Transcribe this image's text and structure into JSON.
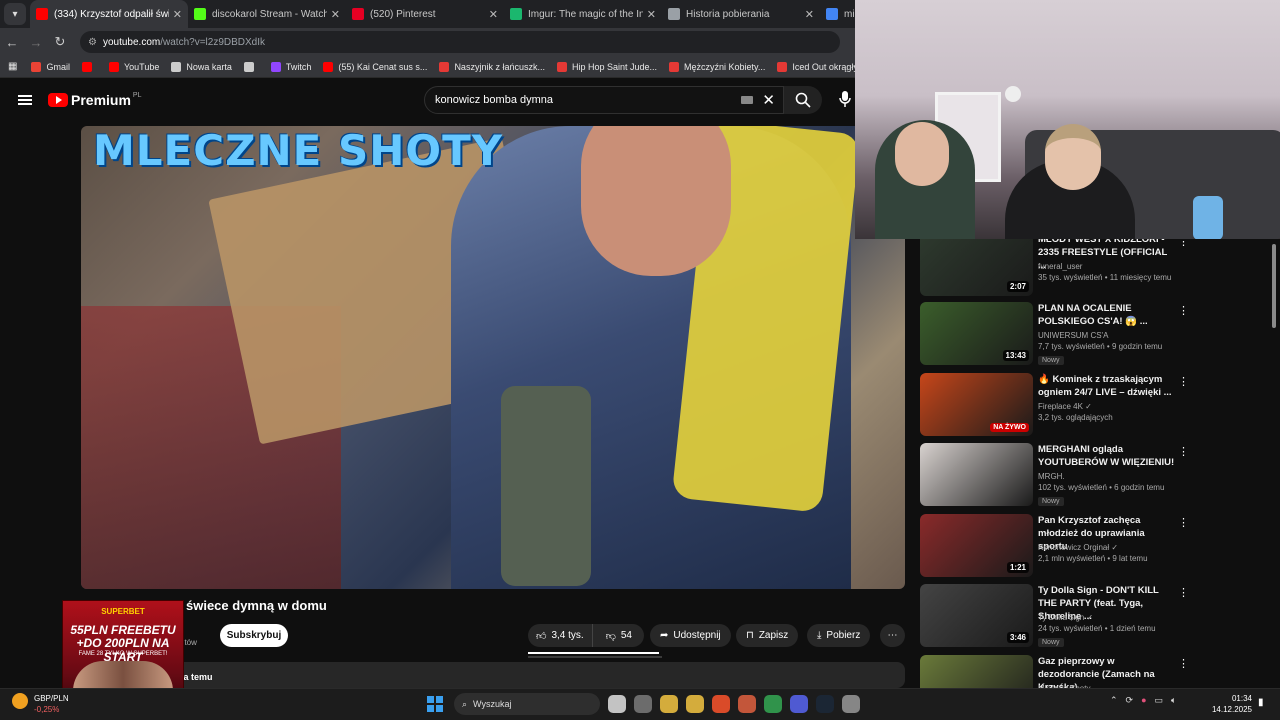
{
  "browser": {
    "tabs": [
      {
        "label": "(334) Krzysztof odpalił świe",
        "active": true,
        "icon": "youtube-icon",
        "color": "#ff0000"
      },
      {
        "label": "discokarol Stream - Watch Live",
        "active": false,
        "icon": "kick-icon",
        "color": "#53fc18"
      },
      {
        "label": "(520) Pinterest",
        "active": false,
        "icon": "pinterest-icon",
        "color": "#e60023"
      },
      {
        "label": "Imgur: The magic of the Interne",
        "active": false,
        "icon": "imgur-icon",
        "color": "#1bb76e"
      },
      {
        "label": "Historia pobierania",
        "active": false,
        "icon": "download-icon",
        "color": "#9aa0a6"
      },
      {
        "label": "mid",
        "active": false,
        "icon": "google-icon",
        "color": "#4285f4"
      }
    ],
    "url_host": "youtube.com",
    "url_path": "/watch?v=l2z9DBDXdIk",
    "bookmarks": [
      {
        "label": "Gmail",
        "color": "#ea4335"
      },
      {
        "label": "",
        "color": "#ff0000"
      },
      {
        "label": "YouTube",
        "color": "#ff0000"
      },
      {
        "label": "Nowa karta",
        "color": "#cccccc"
      },
      {
        "label": "",
        "color": "#cccccc"
      },
      {
        "label": "Twitch",
        "color": "#9146ff"
      },
      {
        "label": "(55) Kai Cenat sus s...",
        "color": "#ff0000"
      },
      {
        "label": "Naszyjnik z łańcuszk...",
        "color": "#e53935"
      },
      {
        "label": "Hip Hop Saint Jude...",
        "color": "#e53935"
      },
      {
        "label": "Mężczyźni Kobiety...",
        "color": "#e53935"
      },
      {
        "label": "Iced Out okrągły ini...",
        "color": "#e53935"
      }
    ]
  },
  "youtube": {
    "logo": "Premium",
    "logo_country": "PL",
    "search_value": "konowicz bomba dymna",
    "video_overlay_text": "MLECZNE SHOTY",
    "video_title": "świece dymną w domu",
    "channel_sub": "ntów",
    "subscribe_label": "Subskrybuj",
    "likes": "3,4 tys.",
    "dislikes": "54",
    "share_label": "Udostępnij",
    "save_label": "Zapisz",
    "download_label": "Pobierz",
    "description_meta": "lata temu",
    "like_ratio": 0.98
  },
  "ad": {
    "brand": "SUPERBET",
    "line1": "55PLN FREEBETU",
    "line2": "+DO 200PLN NA START",
    "line3": "FAME 28 TYLKO W SUPERBET!"
  },
  "recommendations": [
    {
      "title": "MŁODY WEST X KIDZLORI - 2335 FREESTYLE (OFFICIAL ...",
      "channel": "funeral_user",
      "meta": "35 tys. wyświetleń • 11 miesięcy temu",
      "duration": "2:07",
      "live": false,
      "new": false,
      "verified": false,
      "thumb_color": "#2e3a2e"
    },
    {
      "title": "PLAN NA OCALENIE POLSKIEGO CS'A! 😱 ...",
      "channel": "UNIWERSUM CS'A",
      "meta": "7,7 tys. wyświetleń • 9 godzin temu",
      "duration": "13:43",
      "live": false,
      "new": true,
      "verified": false,
      "thumb_color": "#3b5e2b"
    },
    {
      "title": "🔥 Kominek z trzaskającym ogniem 24/7 LIVE – dźwięki ...",
      "channel": "Fireplace 4K",
      "meta": "3,2 tys. oglądających",
      "duration": "NA ŻYWO",
      "live": true,
      "new": false,
      "verified": true,
      "thumb_color": "#c6461a"
    },
    {
      "title": "MERGHANI ogląda YOUTUBERÓW W WIĘZIENIU!",
      "channel": "MRGH.",
      "meta": "102 tys. wyświetleń • 6 godzin temu",
      "duration": "",
      "live": false,
      "new": true,
      "verified": false,
      "thumb_color": "#d8d2cf"
    },
    {
      "title": "Pan Krzysztof zachęca młodzież do uprawiania sportu",
      "channel": "Kononowicz Orginał",
      "meta": "2,1 mln wyświetleń • 9 lat temu",
      "duration": "1:21",
      "live": false,
      "new": false,
      "verified": true,
      "thumb_color": "#8a2a2a"
    },
    {
      "title": "Ty Dolla Sign - DON'T KILL THE PARTY (feat. Tyga, Shoreline ...",
      "channel": "Ty Dolla $ign",
      "meta": "24 tys. wyświetleń • 1 dzień temu",
      "duration": "3:46",
      "live": false,
      "new": true,
      "verified": true,
      "thumb_color": "#444444"
    },
    {
      "title": "Gaz pieprzowy w dezodorancie (Zamach na Krzyśka)",
      "channel": "Mleczne Shoty",
      "meta": "",
      "duration": "",
      "live": false,
      "new": false,
      "verified": false,
      "thumb_color": "#6a7a3a"
    }
  ],
  "taskbar": {
    "currency": "GBP/PLN",
    "currency_change": "-0,25%",
    "search_placeholder": "Wyszukaj",
    "time": "01:34",
    "date": "14.12.2025",
    "apps": [
      "file-explorer-icon",
      "task-view-icon",
      "store-icon",
      "folder-icon",
      "brave-icon",
      "app-icon",
      "chrome-icon",
      "discord-icon",
      "steam-icon",
      "settings-icon"
    ]
  }
}
